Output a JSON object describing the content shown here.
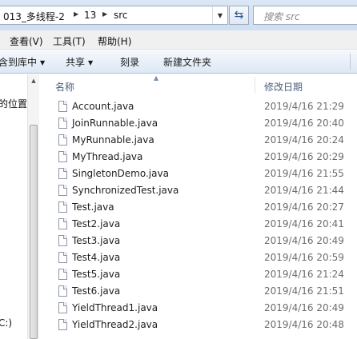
{
  "address_bar": {
    "crumbs": [
      "013_多线程-2",
      "13",
      "src"
    ],
    "dropdown_icon": "chevron-down-icon",
    "refresh_icon": "refresh-icon"
  },
  "search": {
    "placeholder": "搜索 src"
  },
  "menu": [
    "查看(V)",
    "工具(T)",
    "帮助(H)"
  ],
  "toolbar": {
    "include_in_library": "含到库中",
    "share": "共享",
    "burn": "刻录",
    "new_folder": "新建文件夹"
  },
  "nav_pane": {
    "items": [
      "的位置",
      "C:)"
    ]
  },
  "columns": {
    "name": "名称",
    "date_modified": "修改日期"
  },
  "files": [
    {
      "name": "Account.java",
      "date": "2019/4/16 21:29"
    },
    {
      "name": "JoinRunnable.java",
      "date": "2019/4/16 20:40"
    },
    {
      "name": "MyRunnable.java",
      "date": "2019/4/16 20:24"
    },
    {
      "name": "MyThread.java",
      "date": "2019/4/16 20:29"
    },
    {
      "name": "SingletonDemo.java",
      "date": "2019/4/16 21:55"
    },
    {
      "name": "SynchronizedTest.java",
      "date": "2019/4/16 21:44"
    },
    {
      "name": "Test.java",
      "date": "2019/4/16 20:27"
    },
    {
      "name": "Test2.java",
      "date": "2019/4/16 20:41"
    },
    {
      "name": "Test3.java",
      "date": "2019/4/16 20:49"
    },
    {
      "name": "Test4.java",
      "date": "2019/4/16 20:59"
    },
    {
      "name": "Test5.java",
      "date": "2019/4/16 21:24"
    },
    {
      "name": "Test6.java",
      "date": "2019/4/16 21:51"
    },
    {
      "name": "YieldThread1.java",
      "date": "2019/4/16 20:49"
    },
    {
      "name": "YieldThread2.java",
      "date": "2019/4/16 20:48"
    }
  ]
}
